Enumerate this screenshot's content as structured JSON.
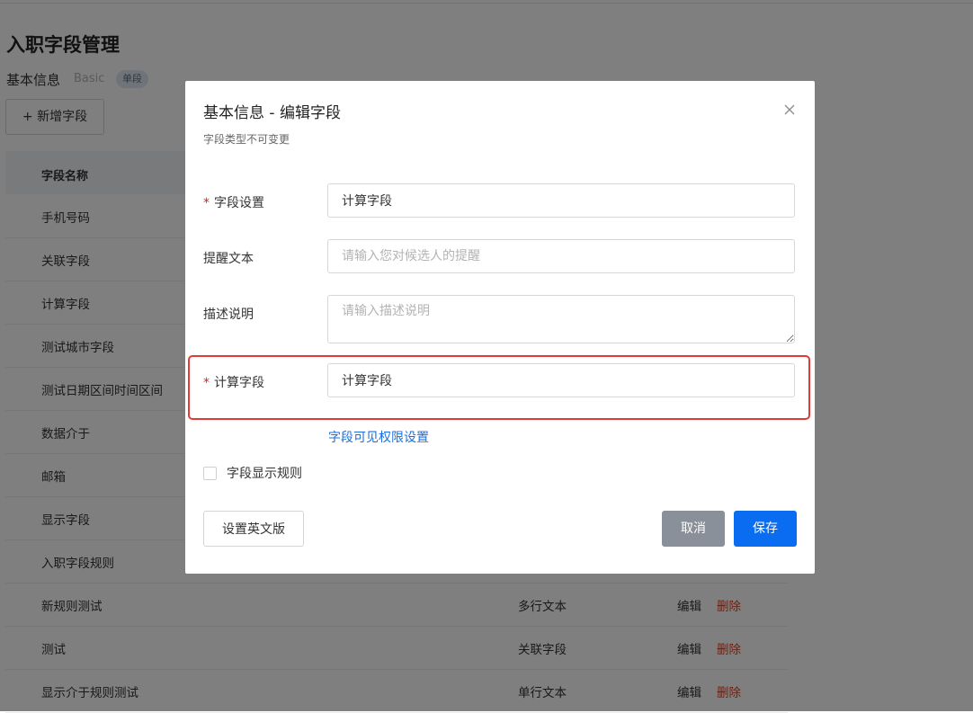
{
  "page": {
    "title": "入职字段管理",
    "section_label": "基本信息",
    "section_sub": "Basic",
    "section_badge": "单段",
    "add_button": "+ 新增字段"
  },
  "table": {
    "header_name": "字段名称",
    "rows": [
      {
        "name": "手机号码",
        "type": "",
        "edit": "",
        "delete": ""
      },
      {
        "name": "关联字段",
        "type": "",
        "edit": "",
        "delete": ""
      },
      {
        "name": "计算字段",
        "type": "",
        "edit": "",
        "delete": ""
      },
      {
        "name": "测试城市字段",
        "type": "",
        "edit": "",
        "delete": ""
      },
      {
        "name": "测试日期区间时间区间",
        "type": "",
        "edit": "",
        "delete": ""
      },
      {
        "name": "数据介于",
        "type": "",
        "edit": "",
        "delete": ""
      },
      {
        "name": "邮箱",
        "type": "",
        "edit": "",
        "delete": ""
      },
      {
        "name": "显示字段",
        "type": "",
        "edit": "",
        "delete": ""
      },
      {
        "name": "入职字段规则",
        "type": "",
        "edit": "",
        "delete": ""
      },
      {
        "name": "新规则测试",
        "type": "多行文本",
        "edit": "编辑",
        "delete": "删除"
      },
      {
        "name": "测试",
        "type": "关联字段",
        "edit": "编辑",
        "delete": "删除"
      },
      {
        "name": "显示介于规则测试",
        "type": "单行文本",
        "edit": "编辑",
        "delete": "删除"
      }
    ]
  },
  "modal": {
    "title": "基本信息 - 编辑字段",
    "subtitle": "字段类型不可变更",
    "close_icon": "close-icon",
    "required_mark": "*",
    "field_setting": {
      "label": "字段设置",
      "value": "计算字段"
    },
    "reminder_text": {
      "label": "提醒文本",
      "placeholder": "请输入您对候选人的提醒"
    },
    "description": {
      "label": "描述说明",
      "placeholder": "请输入描述说明"
    },
    "calc_field": {
      "label": "计算字段",
      "value": "计算字段"
    },
    "visibility_link": "字段可见权限设置",
    "display_rule_label": "字段显示规则",
    "english_button": "设置英文版",
    "cancel_button": "取消",
    "save_button": "保存"
  },
  "colors": {
    "primary": "#0a6cf0",
    "danger": "#e0411f",
    "highlight_border": "#e53935",
    "cancel_bg": "#8a9099"
  }
}
